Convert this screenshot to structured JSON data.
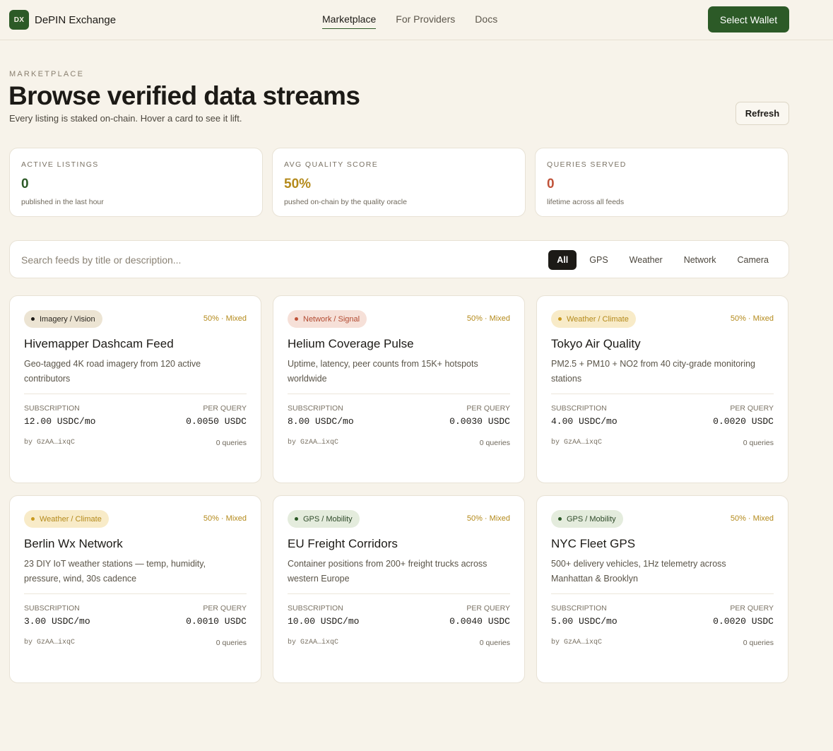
{
  "header": {
    "logo_text": "DX",
    "brand": "DePIN Exchange",
    "nav": [
      {
        "label": "Marketplace",
        "active": true
      },
      {
        "label": "For Providers",
        "active": false
      },
      {
        "label": "Docs",
        "active": false
      }
    ],
    "wallet_button": "Select Wallet"
  },
  "page": {
    "eyebrow": "MARKETPLACE",
    "title": "Browse verified data streams",
    "subtitle": "Every listing is staked on-chain. Hover a card to see it lift.",
    "refresh_button": "Refresh"
  },
  "stats": [
    {
      "label": "ACTIVE LISTINGS",
      "value": "0",
      "note": "published in the last hour",
      "color": "#2c5a27"
    },
    {
      "label": "AVG QUALITY SCORE",
      "value": "50%",
      "note": "pushed on-chain by the quality oracle",
      "color": "#b48a1b"
    },
    {
      "label": "QUERIES SERVED",
      "value": "0",
      "note": "lifetime across all feeds",
      "color": "#c0533a"
    }
  ],
  "search": {
    "placeholder": "Search feeds by title or description...",
    "value": ""
  },
  "filters": [
    {
      "label": "All",
      "active": true
    },
    {
      "label": "GPS",
      "active": false
    },
    {
      "label": "Weather",
      "active": false
    },
    {
      "label": "Network",
      "active": false
    },
    {
      "label": "Camera",
      "active": false
    }
  ],
  "labels": {
    "subscription": "SUBSCRIPTION",
    "per_query": "PER QUERY"
  },
  "feeds": [
    {
      "tag": "Imagery / Vision",
      "tag_bg": "#ece4d3",
      "tag_color": "#2a261f",
      "dot_color": "#1c1a16",
      "quality": "50% · Mixed",
      "title": "Hivemapper Dashcam Feed",
      "description": "Geo-tagged 4K road imagery from 120 active contributors",
      "subscription": "12.00 USDC/mo",
      "per_query": "0.0050 USDC",
      "provider": "by  GzAA…ixqC",
      "queries": "0 queries"
    },
    {
      "tag": "Network / Signal",
      "tag_bg": "#f6e0d8",
      "tag_color": "#b24a31",
      "dot_color": "#c0533a",
      "quality": "50% · Mixed",
      "title": "Helium Coverage Pulse",
      "description": "Uptime, latency, peer counts from 15K+ hotspots worldwide",
      "subscription": "8.00 USDC/mo",
      "per_query": "0.0030 USDC",
      "provider": "by  GzAA…ixqC",
      "queries": "0 queries"
    },
    {
      "tag": "Weather / Climate",
      "tag_bg": "#f8ebc8",
      "tag_color": "#b48a1b",
      "dot_color": "#c99a1e",
      "quality": "50% · Mixed",
      "title": "Tokyo Air Quality",
      "description": "PM2.5 + PM10 + NO2 from 40 city-grade monitoring stations",
      "subscription": "4.00 USDC/mo",
      "per_query": "0.0020 USDC",
      "provider": "by  GzAA…ixqC",
      "queries": "0 queries"
    },
    {
      "tag": "Weather / Climate",
      "tag_bg": "#f8ebc8",
      "tag_color": "#b48a1b",
      "dot_color": "#c99a1e",
      "quality": "50% · Mixed",
      "title": "Berlin Wx Network",
      "description": "23 DIY IoT weather stations — temp, humidity, pressure, wind, 30s cadence",
      "subscription": "3.00 USDC/mo",
      "per_query": "0.0010 USDC",
      "provider": "by  GzAA…ixqC",
      "queries": "0 queries"
    },
    {
      "tag": "GPS / Mobility",
      "tag_bg": "#e4ecdd",
      "tag_color": "#2e4a29",
      "dot_color": "#2c5a27",
      "quality": "50% · Mixed",
      "title": "EU Freight Corridors",
      "description": "Container positions from 200+ freight trucks across western Europe",
      "subscription": "10.00 USDC/mo",
      "per_query": "0.0040 USDC",
      "provider": "by  GzAA…ixqC",
      "queries": "0 queries"
    },
    {
      "tag": "GPS / Mobility",
      "tag_bg": "#e4ecdd",
      "tag_color": "#2e4a29",
      "dot_color": "#2c5a27",
      "quality": "50% · Mixed",
      "title": "NYC Fleet GPS",
      "description": "500+ delivery vehicles, 1Hz telemetry across Manhattan & Brooklyn",
      "subscription": "5.00 USDC/mo",
      "per_query": "0.0020 USDC",
      "provider": "by  GzAA…ixqC",
      "queries": "0 queries"
    }
  ]
}
